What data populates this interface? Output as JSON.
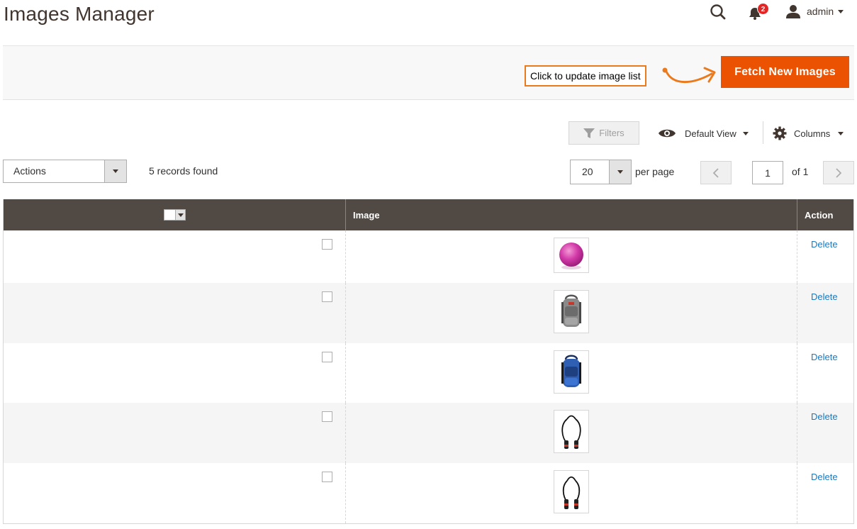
{
  "header": {
    "title": "Images Manager",
    "notifications_count": "2",
    "user_name": "admin"
  },
  "action_bar": {
    "callout_text": "Click to update image list",
    "fetch_button_label": "Fetch New Images"
  },
  "toolbar": {
    "filters_label": "Filters",
    "view_label": "Default View",
    "columns_label": "Columns",
    "actions_label": "Actions",
    "records_found": "5 records found",
    "per_page_value": "20",
    "per_page_label": "per page",
    "current_page": "1",
    "of_pages": "of 1"
  },
  "grid": {
    "columns": [
      "",
      "Image",
      "Action"
    ],
    "rows": [
      {
        "image": "pink-ball-icon",
        "action": "Delete"
      },
      {
        "image": "gray-backpack-icon",
        "action": "Delete"
      },
      {
        "image": "blue-backpack-icon",
        "action": "Delete"
      },
      {
        "image": "jump-rope-icon",
        "action": "Delete"
      },
      {
        "image": "jump-rope-icon",
        "action": "Delete"
      }
    ]
  },
  "colors": {
    "accent": "#eb5202",
    "callout_border": "#eb7a1d",
    "grid_header": "#514943",
    "link": "#1979c3",
    "badge": "#e22626"
  }
}
